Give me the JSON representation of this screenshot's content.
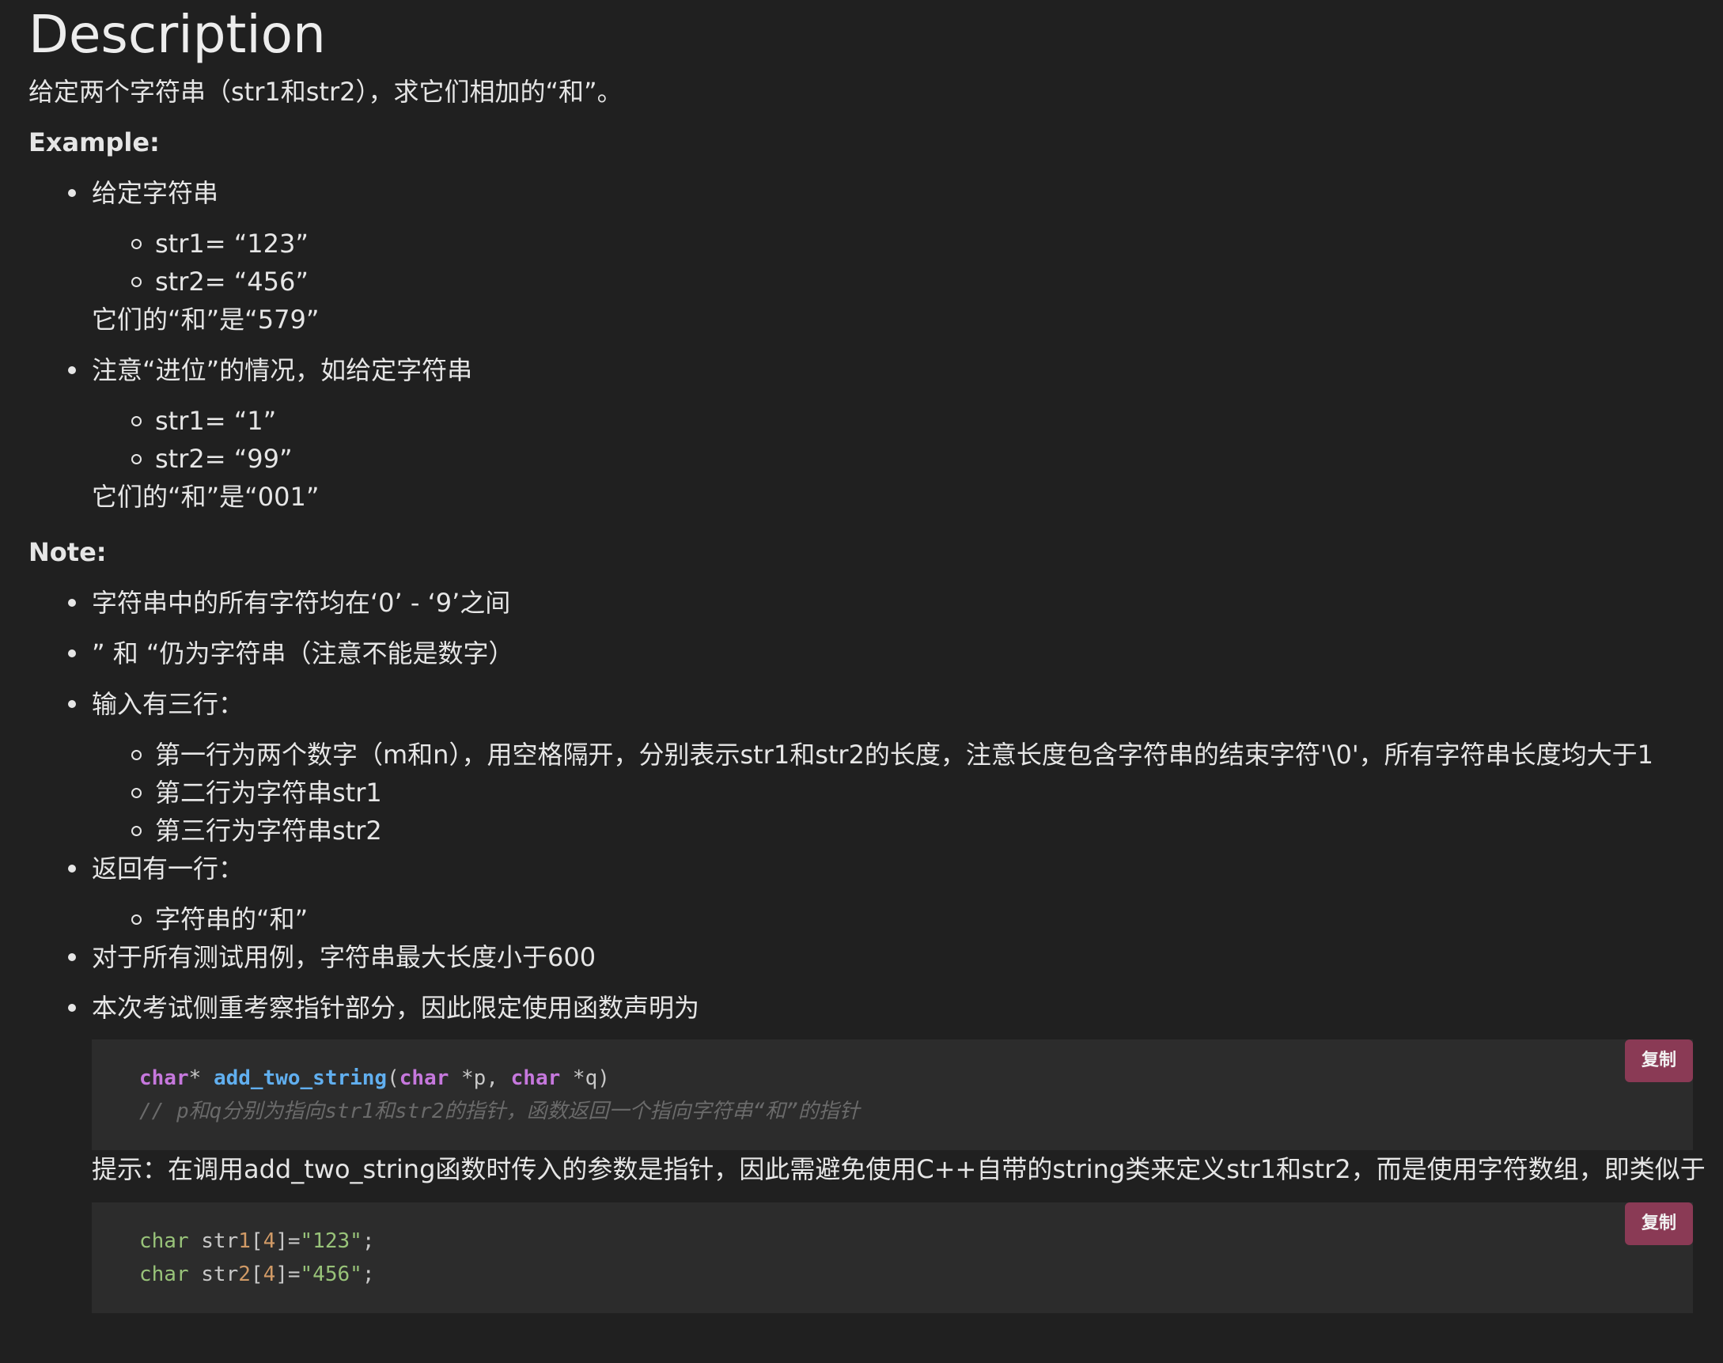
{
  "title": "Description",
  "intro": "给定两个字符串（str1和str2），求它们相加的“和”。",
  "example": {
    "heading": "Example:",
    "items": [
      {
        "text": "给定字符串",
        "sub": [
          "str1= “123”",
          "str2= “456”"
        ],
        "after": "它们的“和”是“579”"
      },
      {
        "text": "注意“进位”的情况，如给定字符串",
        "sub": [
          "str1= “1”",
          "str2= “99”"
        ],
        "after": "它们的“和”是“001”"
      }
    ]
  },
  "note": {
    "heading": "Note:",
    "items": [
      {
        "text": "字符串中的所有字符均在‘0’ - ‘9’之间"
      },
      {
        "text": "” 和 “仍为字符串（注意不能是数字）"
      },
      {
        "text": "输入有三行：",
        "sub": [
          "第一行为两个数字（m和n），用空格隔开，分别表示str1和str2的长度，注意长度包含字符串的结束字符'\\0'，所有字符串长度均大于1",
          "第二行为字符串str1",
          "第三行为字符串str2"
        ]
      },
      {
        "text": "返回有一行：",
        "sub": [
          "字符串的“和”"
        ]
      },
      {
        "text": "对于所有测试用例，字符串最大长度小于600"
      },
      {
        "text": "本次考试侧重考察指针部分，因此限定使用函数声明为"
      }
    ]
  },
  "code1": {
    "copy_label": "复制",
    "line1": {
      "t1": "char",
      "t2": "* ",
      "t3": "add_two_string",
      "t4": "(",
      "t5": "char",
      "t6": " *p, ",
      "t7": "char",
      "t8": " *q)"
    },
    "line2": "// p和q分别为指向str1和str2的指针，函数返回一个指向字符串“和”的指针"
  },
  "hint": "提示：在调用add_two_string函数时传入的参数是指针，因此需避免使用C++自带的string类来定义str1和str2，而是使用字符数组，即类似于",
  "code2": {
    "copy_label": "复制",
    "line1": {
      "t1": "char",
      "t2": " str",
      "t3": "1",
      "t4": "[",
      "t5": "4",
      "t6": "]=",
      "t7": "\"123\"",
      "t8": ";"
    },
    "line2": {
      "t1": "char",
      "t2": " str",
      "t3": "2",
      "t4": "[",
      "t5": "4",
      "t6": "]=",
      "t7": "\"456\"",
      "t8": ";"
    }
  },
  "colors": {
    "background": "#202020",
    "code_background": "#2c2c2c",
    "copy_button": "#8a3a55",
    "keyword": "#c678dd",
    "function": "#61afef",
    "comment": "#6a6a6a"
  }
}
